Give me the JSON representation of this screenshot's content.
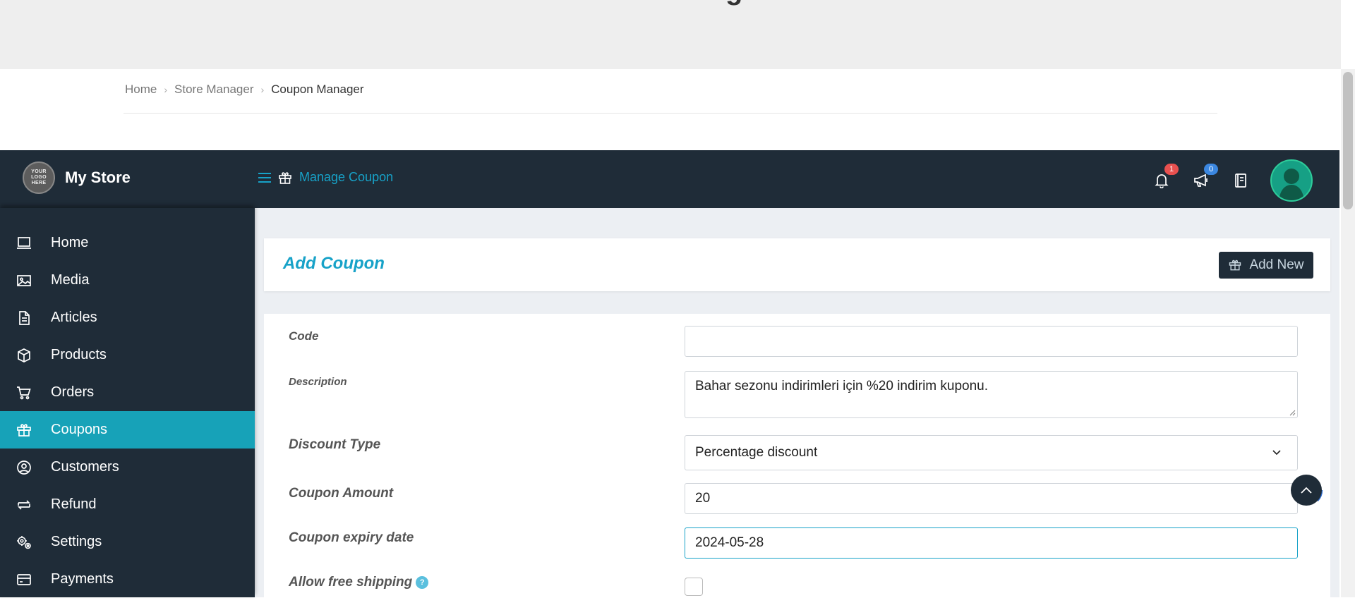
{
  "breadcrumb": {
    "home": "Home",
    "store_manager": "Store Manager",
    "current": "Coupon Manager"
  },
  "brand": {
    "logo_text": "YOUR LOGO HERE",
    "name": "My Store"
  },
  "topbar": {
    "page_title": "Manage Coupon",
    "notifications_count": "1",
    "announcements_count": "0"
  },
  "sidebar": {
    "items": [
      {
        "label": "Home",
        "icon": "laptop-icon"
      },
      {
        "label": "Media",
        "icon": "image-icon"
      },
      {
        "label": "Articles",
        "icon": "document-icon"
      },
      {
        "label": "Products",
        "icon": "box-icon"
      },
      {
        "label": "Orders",
        "icon": "cart-icon"
      },
      {
        "label": "Coupons",
        "icon": "gift-icon",
        "active": true
      },
      {
        "label": "Customers",
        "icon": "user-circle-icon"
      },
      {
        "label": "Refund",
        "icon": "refund-icon"
      },
      {
        "label": "Settings",
        "icon": "gears-icon"
      },
      {
        "label": "Payments",
        "icon": "credit-card-icon"
      }
    ]
  },
  "header": {
    "title": "Add Coupon",
    "add_new_label": "Add New"
  },
  "form": {
    "code": {
      "label": "Code",
      "value": ""
    },
    "description": {
      "label": "Description",
      "value": "Bahar sezonu indirimleri için %20 indirim kuponu."
    },
    "discount_type": {
      "label": "Discount Type",
      "value": "Percentage discount"
    },
    "coupon_amount": {
      "label": "Coupon Amount",
      "value": "20"
    },
    "expiry_date": {
      "label": "Coupon expiry date",
      "value": "2024-05-28"
    },
    "free_shipping": {
      "label": "Allow free shipping",
      "checked": false
    }
  },
  "colors": {
    "sidebar_bg": "#1f2c38",
    "accent": "#17a2b8",
    "badge_red": "#e8504f",
    "badge_blue": "#3b87e0"
  }
}
